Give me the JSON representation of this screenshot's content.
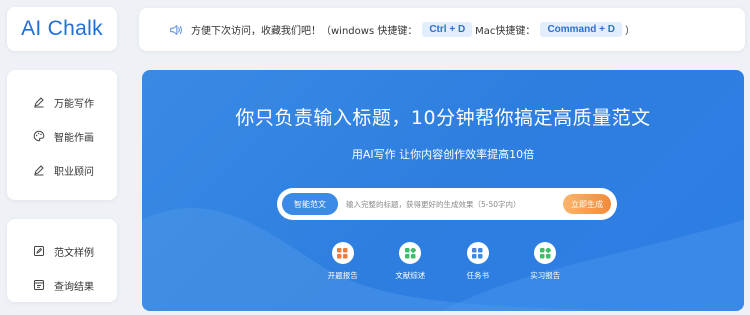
{
  "logo": {
    "text": "AI Chalk"
  },
  "notice": {
    "text_before": "方便下次访问，收藏我们吧！（windows 快捷键：",
    "windows_shortcut": "Ctrl + D",
    "mac_label": "Mac快捷键：",
    "mac_shortcut": "Command + D",
    "text_after": "）"
  },
  "sidebar": {
    "group1": [
      {
        "label": "万能写作",
        "icon": "pen-icon"
      },
      {
        "label": "智能作画",
        "icon": "palette-icon"
      },
      {
        "label": "职业顾问",
        "icon": "pen-icon"
      }
    ],
    "group2": [
      {
        "label": "范文样例",
        "icon": "edit-doc-icon"
      },
      {
        "label": "查询结果",
        "icon": "document-icon"
      }
    ]
  },
  "hero": {
    "title": "你只负责输入标题，10分钟帮你搞定高质量范文",
    "subtitle": "用AI写作 让你内容创作效率提高10倍",
    "mode_label": "智能范文",
    "search_placeholder": "输入完整的标题，获得更好的生成效果（5-50字内）",
    "generate_label": "立即生成"
  },
  "features": [
    {
      "label": "开题报告",
      "color": "#f07a3c"
    },
    {
      "label": "文献综述",
      "color": "#3cbf6a"
    },
    {
      "label": "任务书",
      "color": "#3b8ae6"
    },
    {
      "label": "实习报告",
      "color": "#3cbf6a"
    }
  ],
  "colors": {
    "brand": "#1f6fd6",
    "hero_bg": "#2e7ee0",
    "accent_orange": "#f28a3a"
  }
}
